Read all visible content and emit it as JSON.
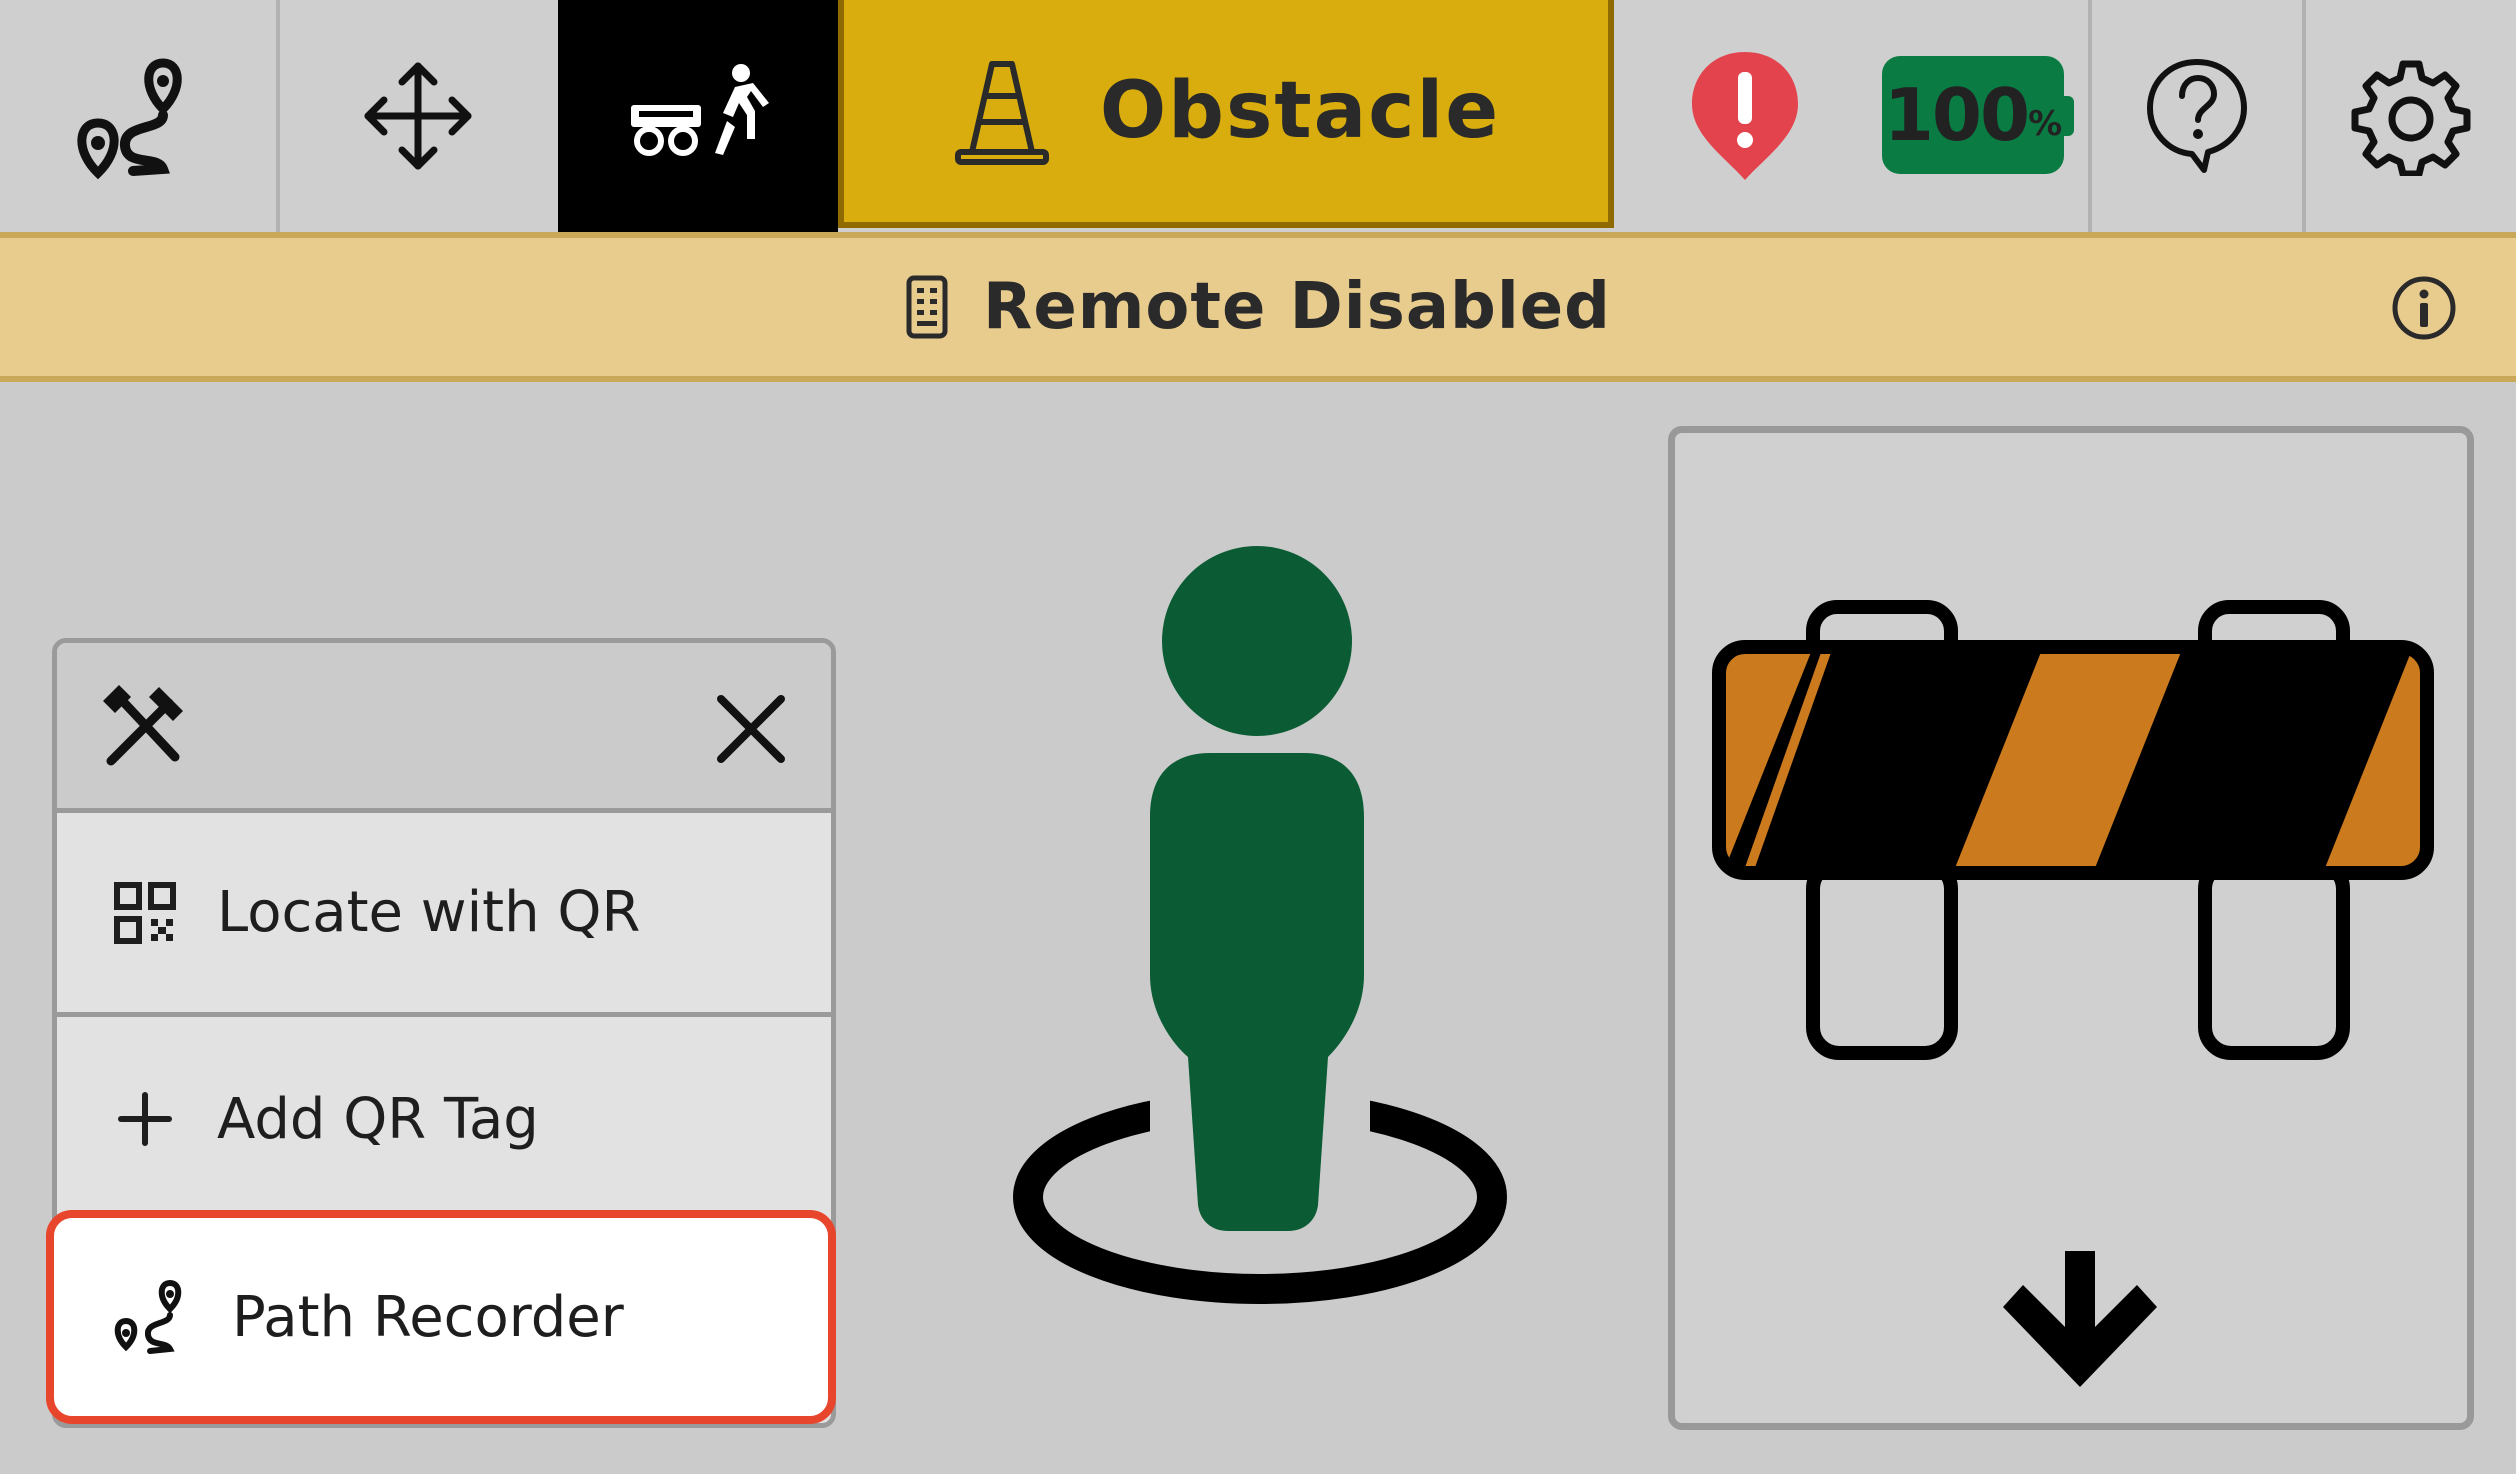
{
  "toolbar": {
    "route_icon": "route-icon",
    "move_icon": "move-arrows-icon",
    "follow_mode_icon": "robot-follow-person-icon",
    "mode_label": "Obstacle",
    "mode_icon": "traffic-cone-icon",
    "alert_icon": "alert-pin-icon",
    "battery_value": "100",
    "battery_unit": "%",
    "help_icon": "help-icon",
    "settings_icon": "gear-icon",
    "colors": {
      "mode_bg": "#d8ad0d",
      "alert": "#e2434d",
      "battery": "#0a7c43",
      "banner": "#e8cc8e"
    }
  },
  "banner": {
    "icon": "remote-control-icon",
    "text": "Remote Disabled",
    "info_icon": "info-icon"
  },
  "tools_menu": {
    "header_icon": "tools-icon",
    "close_icon": "close-icon",
    "items": [
      {
        "icon": "qr-code-icon",
        "label": "Locate with QR"
      },
      {
        "icon": "plus-icon",
        "label": "Add QR Tag"
      },
      {
        "icon": "route-icon",
        "label": "Path Recorder"
      }
    ]
  },
  "main": {
    "person_icon": "person-location-icon",
    "obstacle_card_icon": "road-barrier-icon",
    "down_arrow_icon": "arrow-down-icon",
    "person_color": "#0b5c34",
    "barrier_color": "#cc7a1e"
  }
}
